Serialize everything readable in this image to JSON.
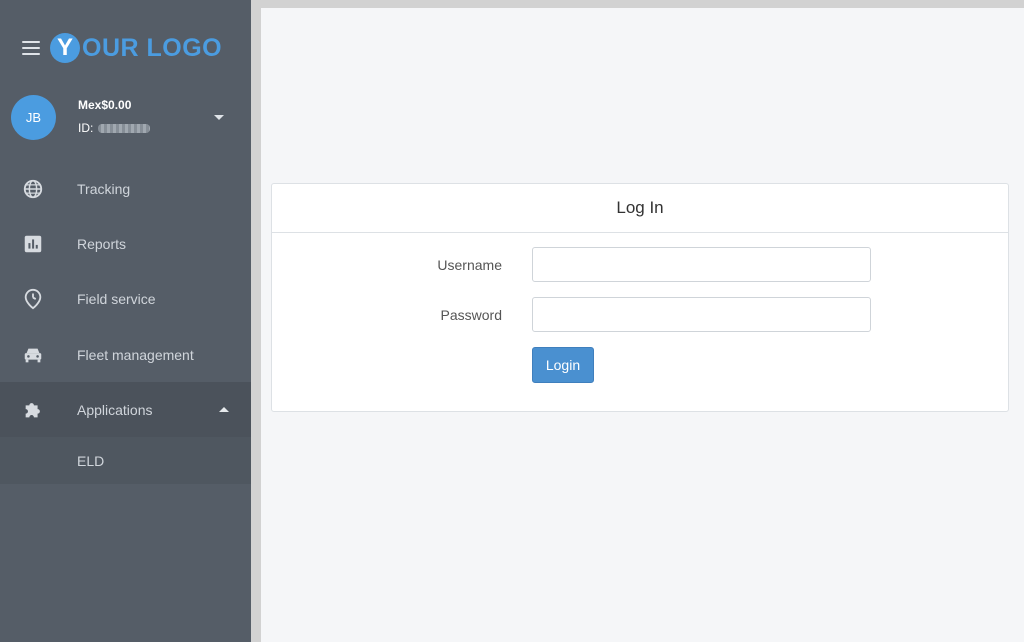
{
  "logo": {
    "letter": "Y",
    "text": "OUR LOGO",
    "color": "#4b9ce0"
  },
  "user": {
    "initials": "JB",
    "balance": "Mex$0.00",
    "id_label": "ID:"
  },
  "sidebar": {
    "items": [
      {
        "label": "Tracking",
        "icon": "globe-icon"
      },
      {
        "label": "Reports",
        "icon": "bar-chart-icon"
      },
      {
        "label": "Field service",
        "icon": "clock-pin-icon"
      },
      {
        "label": "Fleet management",
        "icon": "car-icon"
      },
      {
        "label": "Applications",
        "icon": "puzzle-icon"
      }
    ],
    "subitems": [
      {
        "label": "ELD"
      }
    ]
  },
  "login": {
    "title": "Log In",
    "username_label": "Username",
    "password_label": "Password",
    "username_value": "",
    "password_value": "",
    "button_label": "Login"
  },
  "colors": {
    "sidebar": "#555d67",
    "accent": "#4a90d0"
  }
}
